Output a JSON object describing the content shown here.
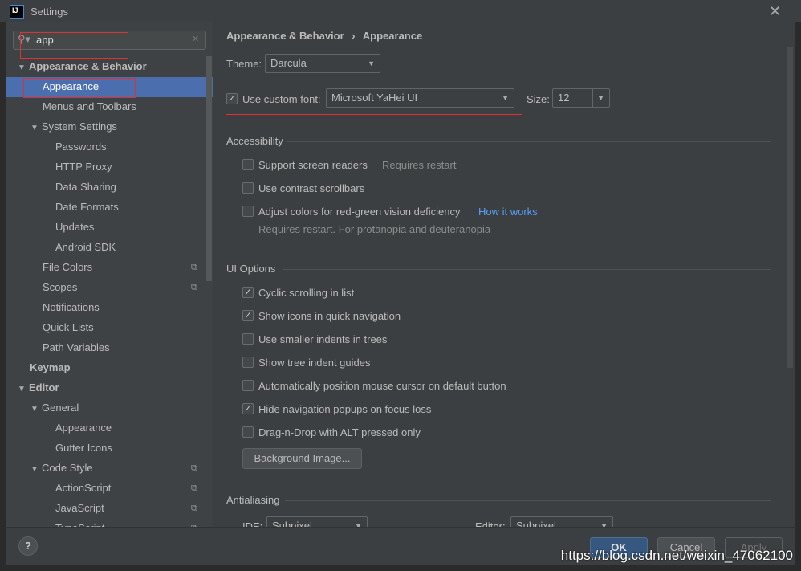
{
  "window": {
    "title": "Settings",
    "logo": "IJ"
  },
  "search": {
    "value": "app"
  },
  "tree": [
    {
      "label": "Appearance & Behavior",
      "level": 0,
      "expanded": true,
      "bold": true
    },
    {
      "label": "Appearance",
      "level": 1,
      "selected": true
    },
    {
      "label": "Menus and Toolbars",
      "level": 1
    },
    {
      "label": "System Settings",
      "level": 1,
      "expanded": true
    },
    {
      "label": "Passwords",
      "level": 2
    },
    {
      "label": "HTTP Proxy",
      "level": 2
    },
    {
      "label": "Data Sharing",
      "level": 2
    },
    {
      "label": "Date Formats",
      "level": 2
    },
    {
      "label": "Updates",
      "level": 2
    },
    {
      "label": "Android SDK",
      "level": 2
    },
    {
      "label": "File Colors",
      "level": 1,
      "copy": true
    },
    {
      "label": "Scopes",
      "level": 1,
      "copy": true
    },
    {
      "label": "Notifications",
      "level": 1
    },
    {
      "label": "Quick Lists",
      "level": 1
    },
    {
      "label": "Path Variables",
      "level": 1
    },
    {
      "label": "Keymap",
      "level": 0,
      "bold": true
    },
    {
      "label": "Editor",
      "level": 0,
      "expanded": true,
      "bold": true
    },
    {
      "label": "General",
      "level": 1,
      "expanded": true
    },
    {
      "label": "Appearance",
      "level": 2
    },
    {
      "label": "Gutter Icons",
      "level": 2
    },
    {
      "label": "Code Style",
      "level": 1,
      "expanded": true,
      "copy": true
    },
    {
      "label": "ActionScript",
      "level": 2,
      "copy": true
    },
    {
      "label": "JavaScript",
      "level": 2,
      "copy": true
    },
    {
      "label": "TypeScript",
      "level": 2,
      "copy": true
    }
  ],
  "breadcrumb": [
    "Appearance & Behavior",
    "Appearance"
  ],
  "theme": {
    "label": "Theme:",
    "value": "Darcula"
  },
  "font": {
    "label": "Use custom font:",
    "checked": true,
    "value": "Microsoft YaHei UI",
    "size_label": "Size:",
    "size": "12"
  },
  "accessibility": {
    "title": "Accessibility",
    "screen_readers": {
      "label": "Support screen readers",
      "checked": false,
      "note": "Requires restart"
    },
    "contrast": {
      "label": "Use contrast scrollbars",
      "checked": false
    },
    "colors": {
      "label": "Adjust colors for red-green vision deficiency",
      "checked": false,
      "link": "How it works",
      "note": "Requires restart. For protanopia and deuteranopia"
    }
  },
  "ui_options": {
    "title": "UI Options",
    "items": [
      {
        "label": "Cyclic scrolling in list",
        "checked": true
      },
      {
        "label": "Show icons in quick navigation",
        "checked": true
      },
      {
        "label": "Use smaller indents in trees",
        "checked": false
      },
      {
        "label": "Show tree indent guides",
        "checked": false
      },
      {
        "label": "Automatically position mouse cursor on default button",
        "checked": false
      },
      {
        "label": "Hide navigation popups on focus loss",
        "checked": true
      },
      {
        "label": "Drag-n-Drop with ALT pressed only",
        "checked": false
      }
    ],
    "bg_button": "Background Image..."
  },
  "antialiasing": {
    "title": "Antialiasing",
    "ide_label": "IDE:",
    "ide_value": "Subpixel",
    "editor_label": "Editor:",
    "editor_value": "Subpixel"
  },
  "footer": {
    "help": "?",
    "ok": "OK",
    "cancel": "Cancel",
    "apply": "Apply"
  },
  "watermark": "https://blog.csdn.net/weixin_47062100"
}
